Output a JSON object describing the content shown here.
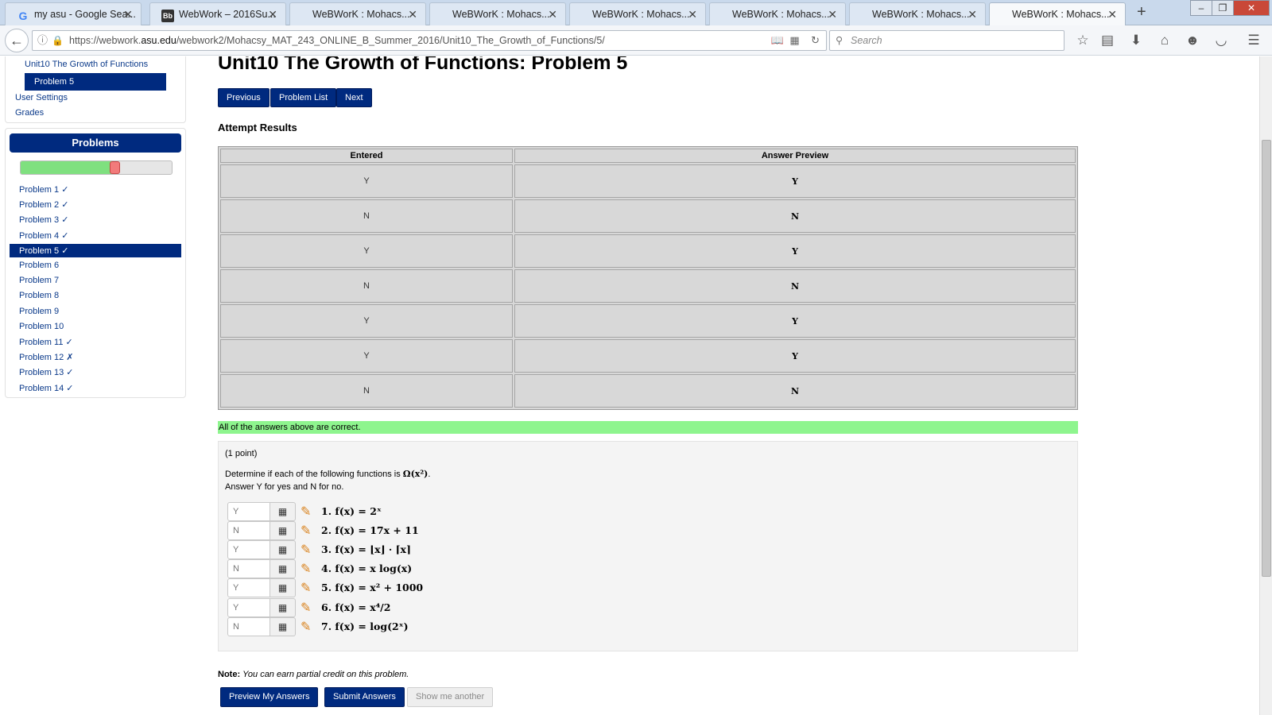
{
  "browser": {
    "tabs": [
      {
        "title": "my asu - Google Sea...",
        "favicon": "google-icon"
      },
      {
        "title": "WebWork – 2016Su...",
        "favicon": "blackboard-icon"
      },
      {
        "title": "WeBWorK : Mohacs...",
        "favicon": "none"
      },
      {
        "title": "WeBWorK : Mohacs...",
        "favicon": "none"
      },
      {
        "title": "WeBWorK : Mohacs...",
        "favicon": "none"
      },
      {
        "title": "WeBWorK : Mohacs...",
        "favicon": "none"
      },
      {
        "title": "WeBWorK : Mohacs...",
        "favicon": "none"
      },
      {
        "title": "WeBWorK : Mohacs...",
        "favicon": "none",
        "active": true
      }
    ],
    "url_prefix": "https://webwork.",
    "url_host": "asu.edu",
    "url_path": "/webwork2/Mohacsy_MAT_243_ONLINE_B_Summer_2016/Unit10_The_Growth_of_Functions/5/",
    "search_placeholder": "Search"
  },
  "sidebar": {
    "links": {
      "unit": "Unit10 The Growth of Functions",
      "problem": "Problem 5",
      "user_settings": "User Settings",
      "grades": "Grades"
    },
    "problems_header": "Problems",
    "progress": {
      "correct_fraction": 0.6,
      "incorrect_fraction": 0.07
    },
    "problems": [
      "Problem 1 ✓",
      "Problem 2 ✓",
      "Problem 3 ✓",
      "Problem 4 ✓",
      "Problem 5 ✓",
      "Problem 6",
      "Problem 7",
      "Problem 8",
      "Problem 9",
      "Problem 10",
      "Problem 11 ✓",
      "Problem 12 ✗",
      "Problem 13 ✓",
      "Problem 14 ✓"
    ],
    "active_problem_index": 4
  },
  "main": {
    "title": "Unit10 The Growth of Functions: Problem 5",
    "nav": {
      "previous": "Previous",
      "list": "Problem List",
      "next": "Next"
    },
    "attempt_heading": "Attempt Results",
    "table": {
      "headers": [
        "Entered",
        "Answer Preview"
      ],
      "rows": [
        [
          "Y",
          "Y"
        ],
        [
          "N",
          "N"
        ],
        [
          "Y",
          "Y"
        ],
        [
          "N",
          "N"
        ],
        [
          "Y",
          "Y"
        ],
        [
          "Y",
          "Y"
        ],
        [
          "N",
          "N"
        ]
      ]
    },
    "correct_message": "All of the answers above are correct.",
    "problem": {
      "points": "(1 point)",
      "instruction_prefix": "Determine if each of the following functions is ",
      "instruction_math": "Ω(x²)",
      "instruction_suffix": ".",
      "instruction_line2": "Answer Y for yes and N for no.",
      "answers": [
        {
          "value": "Y",
          "label": "1. f(x) = 2ˣ"
        },
        {
          "value": "N",
          "label": "2. f(x) = 17x + 11"
        },
        {
          "value": "Y",
          "label": "3. f(x) = ⌊x⌋ · ⌈x⌉"
        },
        {
          "value": "N",
          "label": "4. f(x) = x log(x)"
        },
        {
          "value": "Y",
          "label": "5. f(x) = x² + 1000"
        },
        {
          "value": "Y",
          "label": "6. f(x) = x⁴/2"
        },
        {
          "value": "N",
          "label": "7. f(x) = log(2ˣ)"
        }
      ]
    },
    "note_label": "Note:",
    "note_text": "You can earn partial credit on this problem.",
    "actions": {
      "preview": "Preview My Answers",
      "submit": "Submit Answers",
      "show_another": "Show me another"
    }
  },
  "colors": {
    "accent": "#002a7f",
    "correct_green": "#8ef58e",
    "progress_green": "#7fe07f",
    "progress_red": "#f27b7b"
  }
}
